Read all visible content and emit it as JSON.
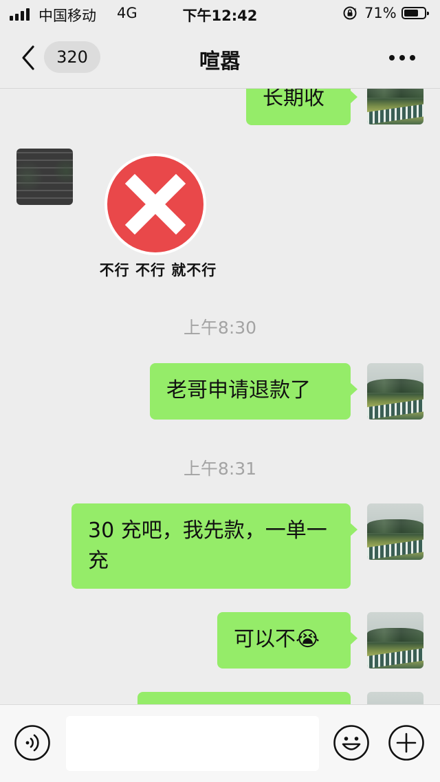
{
  "status_bar": {
    "carrier": "中国移动",
    "network": "4G",
    "time": "下午12:42",
    "battery": "71%",
    "battery_level": 0.71
  },
  "header": {
    "unread_count": "320",
    "title": "喧嚣"
  },
  "messages": [
    {
      "side": "right",
      "text": "长期收"
    },
    {
      "side": "left",
      "type": "sticker",
      "caption": "不行 不行 就不行"
    },
    {
      "type": "time",
      "text": "上午8:30"
    },
    {
      "side": "right",
      "text": "老哥申请退款了"
    },
    {
      "type": "time",
      "text": "上午8:31"
    },
    {
      "side": "right",
      "text": "30 充吧，我先款，一单一充"
    },
    {
      "side": "right",
      "text": "可以不😭"
    },
    {
      "side": "right",
      "text": ""
    }
  ],
  "input_bar": {
    "value": ""
  },
  "colors": {
    "bubble": "#95ec69",
    "background": "#ededed",
    "sticker_red": "#e9484a"
  },
  "icons": [
    "back-icon",
    "more-icon",
    "voice-icon",
    "emoji-icon",
    "plus-icon",
    "screen-lock-icon",
    "signal-icon",
    "battery-icon"
  ]
}
